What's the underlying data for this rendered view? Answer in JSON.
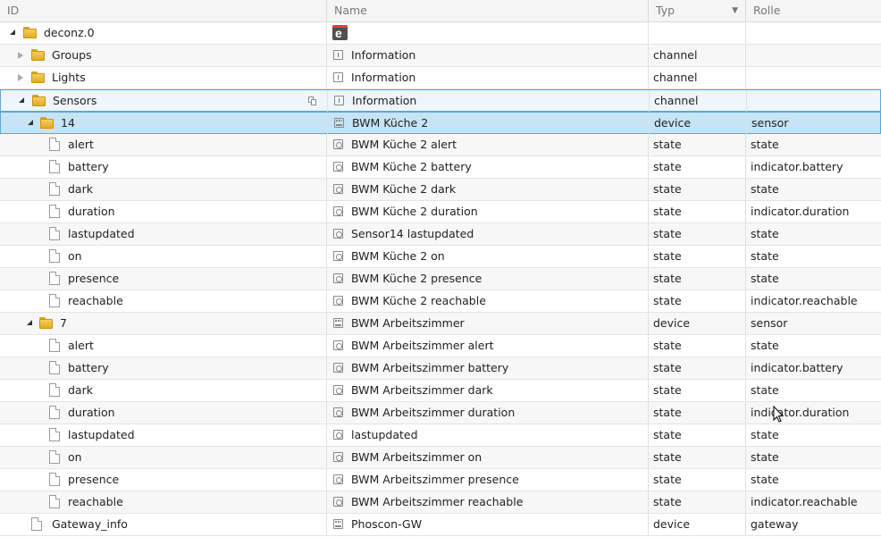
{
  "header": {
    "col_id": "ID",
    "col_name": "Name",
    "col_type": "Typ",
    "col_role": "Rolle",
    "sort_indicator": "▼"
  },
  "rows": [
    {
      "id": "deconz.0",
      "name": "",
      "type": "",
      "role": "",
      "name_icon": "adapter-logo-icon"
    },
    {
      "id": "Groups",
      "name": "Information",
      "type": "channel",
      "role": "",
      "name_icon": "info-icon"
    },
    {
      "id": "Lights",
      "name": "Information",
      "type": "channel",
      "role": "",
      "name_icon": "info-icon"
    },
    {
      "id": "Sensors",
      "name": "Information",
      "type": "channel",
      "role": "",
      "name_icon": "info-icon"
    },
    {
      "id": "14",
      "name": "BWM Küche 2",
      "type": "device",
      "role": "sensor",
      "name_icon": "device-icon"
    },
    {
      "id": "alert",
      "name": "BWM Küche 2 alert",
      "type": "state",
      "role": "state",
      "name_icon": "state-icon"
    },
    {
      "id": "battery",
      "name": "BWM Küche 2 battery",
      "type": "state",
      "role": "indicator.battery",
      "name_icon": "state-icon"
    },
    {
      "id": "dark",
      "name": "BWM Küche 2 dark",
      "type": "state",
      "role": "state",
      "name_icon": "state-icon"
    },
    {
      "id": "duration",
      "name": "BWM Küche 2 duration",
      "type": "state",
      "role": "indicator.duration",
      "name_icon": "state-icon"
    },
    {
      "id": "lastupdated",
      "name": "Sensor14 lastupdated",
      "type": "state",
      "role": "state",
      "name_icon": "state-icon"
    },
    {
      "id": "on",
      "name": "BWM Küche 2 on",
      "type": "state",
      "role": "state",
      "name_icon": "state-icon"
    },
    {
      "id": "presence",
      "name": "BWM Küche 2 presence",
      "type": "state",
      "role": "state",
      "name_icon": "state-icon"
    },
    {
      "id": "reachable",
      "name": "BWM Küche 2 reachable",
      "type": "state",
      "role": "indicator.reachable",
      "name_icon": "state-icon"
    },
    {
      "id": "7",
      "name": "BWM Arbeitszimmer",
      "type": "device",
      "role": "sensor",
      "name_icon": "device-icon"
    },
    {
      "id": "alert",
      "name": "BWM Arbeitszimmer alert",
      "type": "state",
      "role": "state",
      "name_icon": "state-icon"
    },
    {
      "id": "battery",
      "name": "BWM Arbeitszimmer battery",
      "type": "state",
      "role": "indicator.battery",
      "name_icon": "state-icon"
    },
    {
      "id": "dark",
      "name": "BWM Arbeitszimmer dark",
      "type": "state",
      "role": "state",
      "name_icon": "state-icon"
    },
    {
      "id": "duration",
      "name": "BWM Arbeitszimmer duration",
      "type": "state",
      "role": "indicator.duration",
      "name_icon": "state-icon"
    },
    {
      "id": "lastupdated",
      "name": "lastupdated",
      "type": "state",
      "role": "state",
      "name_icon": "state-icon"
    },
    {
      "id": "on",
      "name": "BWM Arbeitszimmer on",
      "type": "state",
      "role": "state",
      "name_icon": "state-icon"
    },
    {
      "id": "presence",
      "name": "BWM Arbeitszimmer presence",
      "type": "state",
      "role": "state",
      "name_icon": "state-icon"
    },
    {
      "id": "reachable",
      "name": "BWM Arbeitszimmer reachable",
      "type": "state",
      "role": "indicator.reachable",
      "name_icon": "state-icon"
    },
    {
      "id": "Gateway_info",
      "name": "Phoscon-GW",
      "type": "device",
      "role": "gateway",
      "name_icon": "device-icon"
    }
  ],
  "colors": {
    "selected_row": "#c6e4f4",
    "selection_border": "#5ea7d6",
    "folder": "#f0c040"
  }
}
